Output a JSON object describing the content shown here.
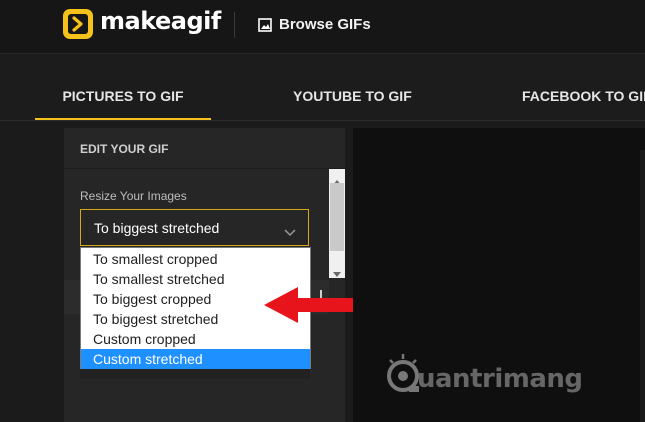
{
  "header": {
    "logo_text": "makeagif",
    "browse_label": "Browse GIFs"
  },
  "tabs": [
    {
      "label": "PICTURES TO GIF",
      "active": true
    },
    {
      "label": "YOUTUBE TO GIF",
      "active": false
    },
    {
      "label": "FACEBOOK TO GIF",
      "active": false
    }
  ],
  "editor": {
    "panel_title": "EDIT YOUR GIF",
    "resize_label": "Resize Your Images",
    "selected_value": "To biggest stretched",
    "options": [
      {
        "label": "To smallest cropped",
        "highlighted": false
      },
      {
        "label": "To smallest stretched",
        "highlighted": false
      },
      {
        "label": "To biggest cropped",
        "highlighted": false
      },
      {
        "label": "To biggest stretched",
        "highlighted": false
      },
      {
        "label": "Custom cropped",
        "highlighted": false
      },
      {
        "label": "Custom stretched",
        "highlighted": true
      }
    ]
  },
  "watermark": {
    "text": "uantrimang"
  },
  "colors": {
    "accent": "#f4c21b",
    "selection": "#1e90ff",
    "annotation_arrow": "#e8141b"
  },
  "icons": [
    "logo-icon",
    "image-icon",
    "chevron-down-icon",
    "scroll-up-icon",
    "scroll-down-icon",
    "red-arrow-icon",
    "lightbulb-icon"
  ]
}
